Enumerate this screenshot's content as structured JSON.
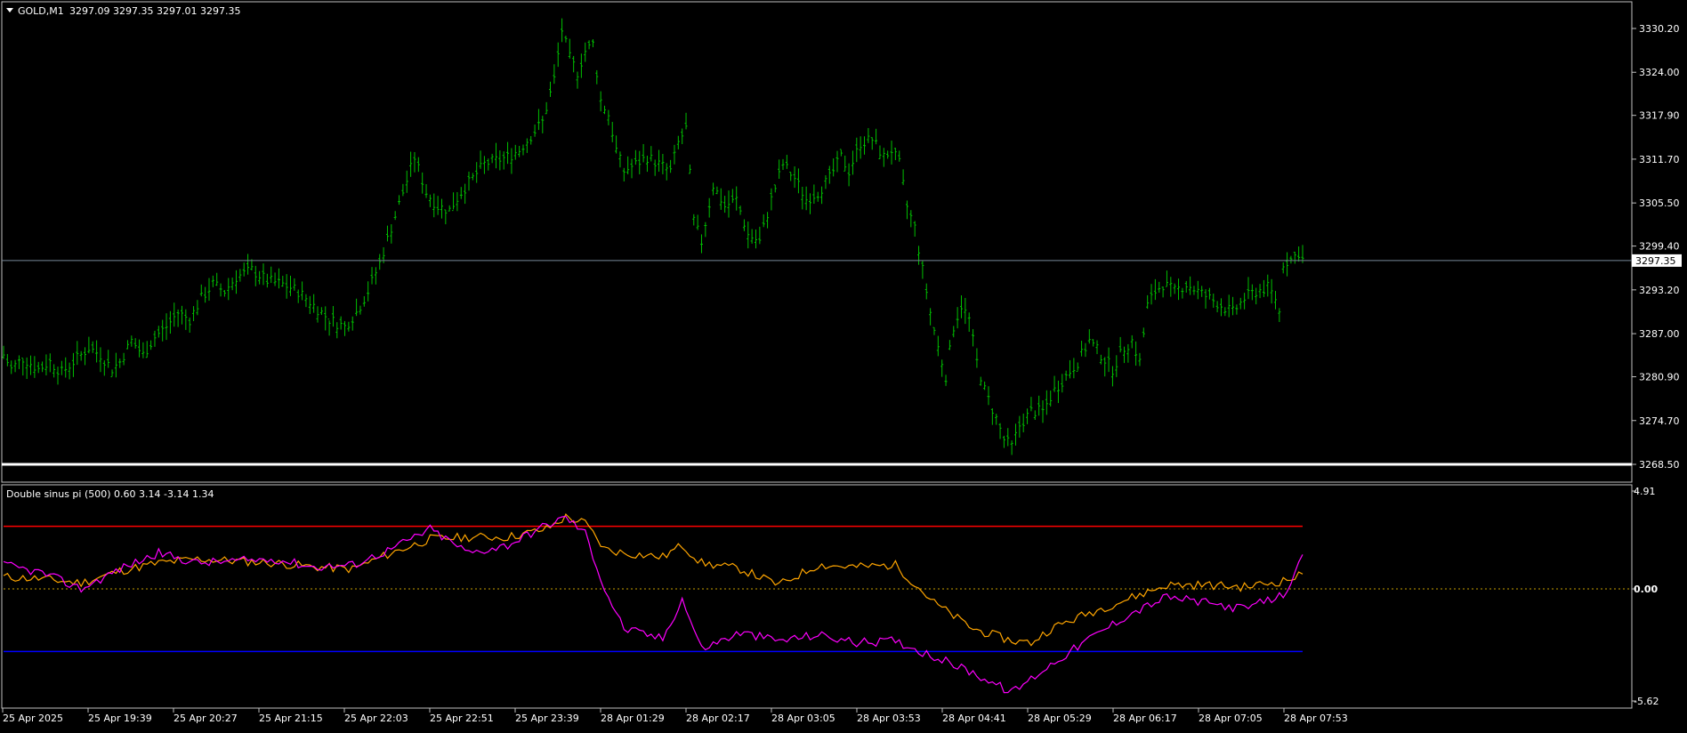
{
  "chart_window": {
    "symbol_header": "GOLD,M1",
    "ohlc_readout": "3297.09 3297.35 3297.01 3297.35",
    "indicator_header": "Double sinus pi (500) 0.60 3.14 -3.14 1.34",
    "current_price_label": "3297.35",
    "colors": {
      "background": "#000000",
      "bars": "#00c000",
      "bid_line": "#778899",
      "upper_level": "#ff0000",
      "lower_level": "#0000ff",
      "zero_level": "#c8a000",
      "orange_line": "#ffa500",
      "magenta_line": "#ff00ff",
      "axis_text": "#ffffff",
      "frame": "#c0c0c0"
    }
  },
  "chart_data": [
    {
      "type": "ohlc",
      "symbol": "GOLD",
      "timeframe": "M1",
      "y_ticks": [
        "3330.20",
        "3324.00",
        "3317.90",
        "3311.70",
        "3305.50",
        "3299.40",
        "3293.20",
        "3287.00",
        "3280.90",
        "3274.70",
        "3268.50"
      ],
      "ylim": [
        3266.0,
        3332.0
      ],
      "current_price": 3297.35,
      "x_labels": [
        "25 Apr 2025",
        "25 Apr 19:39",
        "25 Apr 20:27",
        "25 Apr 21:15",
        "25 Apr 22:03",
        "25 Apr 22:51",
        "25 Apr 23:39",
        "28 Apr 01:29",
        "28 Apr 02:17",
        "28 Apr 03:05",
        "28 Apr 03:53",
        "28 Apr 04:41",
        "28 Apr 05:29",
        "28 Apr 06:17",
        "28 Apr 07:05",
        "28 Apr 07:53"
      ],
      "price_path": [
        [
          0,
          3284
        ],
        [
          2,
          3282
        ],
        [
          5,
          3283.5
        ],
        [
          9,
          3282
        ],
        [
          12,
          3283
        ],
        [
          15,
          3281.5
        ],
        [
          19,
          3283.5
        ],
        [
          22,
          3285
        ],
        [
          25,
          3284
        ],
        [
          28,
          3282
        ],
        [
          30,
          3283
        ],
        [
          33,
          3286
        ],
        [
          36,
          3284
        ],
        [
          39,
          3286.5
        ],
        [
          42,
          3288
        ],
        [
          45,
          3290
        ],
        [
          48,
          3289
        ],
        [
          51,
          3292
        ],
        [
          54,
          3294
        ],
        [
          57,
          3293
        ],
        [
          60,
          3295
        ],
        [
          64,
          3296
        ],
        [
          68,
          3294.5
        ],
        [
          72,
          3294
        ],
        [
          76,
          3293
        ],
        [
          80,
          3291
        ],
        [
          84,
          3289
        ],
        [
          88,
          3288
        ],
        [
          91,
          3290
        ],
        [
          94,
          3293
        ],
        [
          97,
          3297
        ],
        [
          100,
          3302
        ],
        [
          103,
          3307
        ],
        [
          106,
          3312
        ],
        [
          109,
          3307
        ],
        [
          112,
          3305
        ],
        [
          115,
          3304.5
        ],
        [
          118,
          3307
        ],
        [
          121,
          3309
        ],
        [
          124,
          3311
        ],
        [
          127,
          3311.5
        ],
        [
          130,
          3312
        ],
        [
          133,
          3313
        ],
        [
          136,
          3315
        ],
        [
          139,
          3317
        ],
        [
          142,
          3323
        ],
        [
          144,
          3330
        ],
        [
          146,
          3326
        ],
        [
          148,
          3324
        ],
        [
          150,
          3327
        ],
        [
          152,
          3328
        ],
        [
          154,
          3320
        ],
        [
          156,
          3318
        ],
        [
          158,
          3313
        ],
        [
          160,
          3310
        ],
        [
          163,
          3311
        ],
        [
          166,
          3312
        ],
        [
          169,
          3311
        ],
        [
          172,
          3310
        ],
        [
          174,
          3314
        ],
        [
          176,
          3316
        ],
        [
          178,
          3303
        ],
        [
          180,
          3300
        ],
        [
          183,
          3308
        ],
        [
          186,
          3305
        ],
        [
          189,
          3306
        ],
        [
          192,
          3301
        ],
        [
          195,
          3300
        ],
        [
          198,
          3306
        ],
        [
          201,
          3311
        ],
        [
          204,
          3309
        ],
        [
          207,
          3306
        ],
        [
          210,
          3307
        ],
        [
          213,
          3309
        ],
        [
          216,
          3312
        ],
        [
          218,
          3310
        ],
        [
          221,
          3314
        ],
        [
          224,
          3314.5
        ],
        [
          227,
          3312
        ],
        [
          229,
          3313
        ],
        [
          231,
          3311
        ],
        [
          233,
          3305
        ],
        [
          235,
          3302
        ],
        [
          237,
          3296
        ],
        [
          239,
          3290
        ],
        [
          241,
          3285
        ],
        [
          243,
          3281
        ],
        [
          245,
          3288
        ],
        [
          247,
          3291
        ],
        [
          249,
          3289
        ],
        [
          251,
          3283
        ],
        [
          253,
          3279
        ],
        [
          256,
          3275
        ],
        [
          258,
          3272
        ],
        [
          260,
          3271
        ],
        [
          262,
          3274
        ],
        [
          265,
          3276
        ],
        [
          268,
          3276
        ],
        [
          271,
          3279
        ],
        [
          274,
          3281
        ],
        [
          277,
          3283
        ],
        [
          280,
          3286
        ],
        [
          283,
          3284
        ],
        [
          286,
          3282
        ],
        [
          289,
          3285
        ],
        [
          291,
          3286
        ],
        [
          293,
          3283
        ],
        [
          295,
          3291
        ],
        [
          297,
          3293
        ],
        [
          299,
          3294
        ],
        [
          302,
          3293
        ],
        [
          305,
          3294
        ],
        [
          308,
          3293
        ],
        [
          311,
          3292
        ],
        [
          314,
          3291
        ],
        [
          317,
          3290
        ],
        [
          320,
          3292
        ],
        [
          323,
          3293
        ],
        [
          326,
          3293.5
        ],
        [
          328,
          3292
        ],
        [
          329,
          3290
        ],
        [
          330,
          3297
        ],
        [
          332,
          3297.5
        ],
        [
          334,
          3298.5
        ],
        [
          335,
          3297.5
        ]
      ],
      "series": []
    },
    {
      "type": "line",
      "indicator": "Double sinus pi (500)",
      "y_ticks": [
        "4.91",
        "0.00",
        "-5.62"
      ],
      "ylim": [
        -5.62,
        4.91
      ],
      "levels": [
        3.14,
        0.0,
        -3.14
      ],
      "series": [
        {
          "color": "orange",
          "values": [
            [
              0,
              0.6
            ],
            [
              10,
              0.5
            ],
            [
              20,
              0.3
            ],
            [
              30,
              0.9
            ],
            [
              40,
              1.3
            ],
            [
              50,
              1.5
            ],
            [
              60,
              1.4
            ],
            [
              70,
              1.3
            ],
            [
              80,
              1.1
            ],
            [
              90,
              1.0
            ],
            [
              100,
              1.8
            ],
            [
              110,
              2.5
            ],
            [
              120,
              2.6
            ],
            [
              130,
              2.6
            ],
            [
              140,
              3.0
            ],
            [
              145,
              3.6
            ],
            [
              150,
              3.3
            ],
            [
              155,
              2.0
            ],
            [
              160,
              1.8
            ],
            [
              170,
              1.6
            ],
            [
              175,
              2.2
            ],
            [
              180,
              1.3
            ],
            [
              190,
              1.0
            ],
            [
              195,
              0.6
            ],
            [
              200,
              0.2
            ],
            [
              210,
              1.2
            ],
            [
              220,
              1.1
            ],
            [
              230,
              1.2
            ],
            [
              240,
              -0.7
            ],
            [
              250,
              -2.0
            ],
            [
              260,
              -2.6
            ],
            [
              265,
              -2.7
            ],
            [
              270,
              -2.0
            ],
            [
              280,
              -1.2
            ],
            [
              290,
              -0.5
            ],
            [
              300,
              0.2
            ],
            [
              310,
              0.2
            ],
            [
              320,
              0.1
            ],
            [
              330,
              0.4
            ],
            [
              335,
              0.7
            ]
          ]
        },
        {
          "color": "magenta",
          "values": [
            [
              0,
              1.2
            ],
            [
              10,
              0.8
            ],
            [
              20,
              0.0
            ],
            [
              30,
              1.0
            ],
            [
              40,
              1.8
            ],
            [
              50,
              1.3
            ],
            [
              60,
              1.4
            ],
            [
              70,
              1.5
            ],
            [
              80,
              1.1
            ],
            [
              90,
              1.2
            ],
            [
              100,
              2.0
            ],
            [
              110,
              3.0
            ],
            [
              120,
              1.8
            ],
            [
              130,
              2.2
            ],
            [
              140,
              3.2
            ],
            [
              145,
              3.6
            ],
            [
              150,
              2.8
            ],
            [
              155,
              0.0
            ],
            [
              160,
              -2.0
            ],
            [
              170,
              -2.5
            ],
            [
              175,
              -0.5
            ],
            [
              180,
              -3.0
            ],
            [
              190,
              -2.2
            ],
            [
              200,
              -2.6
            ],
            [
              210,
              -2.3
            ],
            [
              220,
              -2.7
            ],
            [
              230,
              -2.6
            ],
            [
              240,
              -3.4
            ],
            [
              250,
              -4.2
            ],
            [
              260,
              -5.2
            ],
            [
              270,
              -3.8
            ],
            [
              280,
              -2.5
            ],
            [
              290,
              -1.3
            ],
            [
              300,
              -0.4
            ],
            [
              310,
              -0.7
            ],
            [
              320,
              -1.0
            ],
            [
              330,
              -0.3
            ],
            [
              335,
              1.5
            ]
          ]
        }
      ]
    }
  ]
}
